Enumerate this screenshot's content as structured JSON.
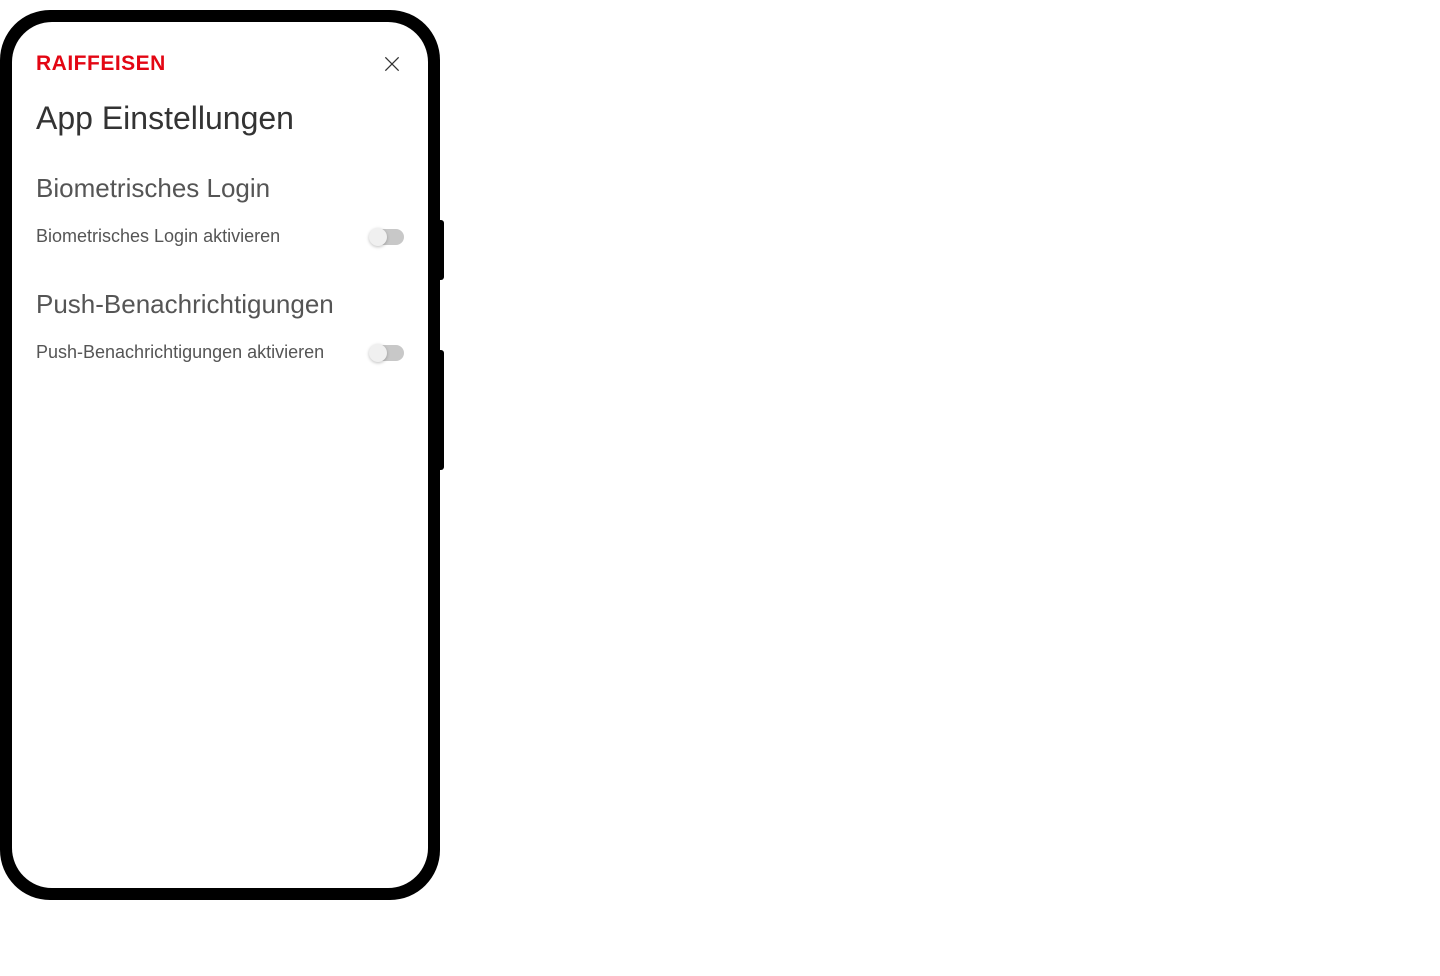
{
  "header": {
    "brand": "RAIFFEISEN"
  },
  "page": {
    "title": "App Einstellungen"
  },
  "sections": {
    "biometric": {
      "title": "Biometrisches Login",
      "toggle_label": "Biometrisches Login aktivieren",
      "toggle_state": false
    },
    "push": {
      "title": "Push-Benachrichtigungen",
      "toggle_label": "Push-Benachrichtigungen aktivieren",
      "toggle_state": false
    }
  }
}
